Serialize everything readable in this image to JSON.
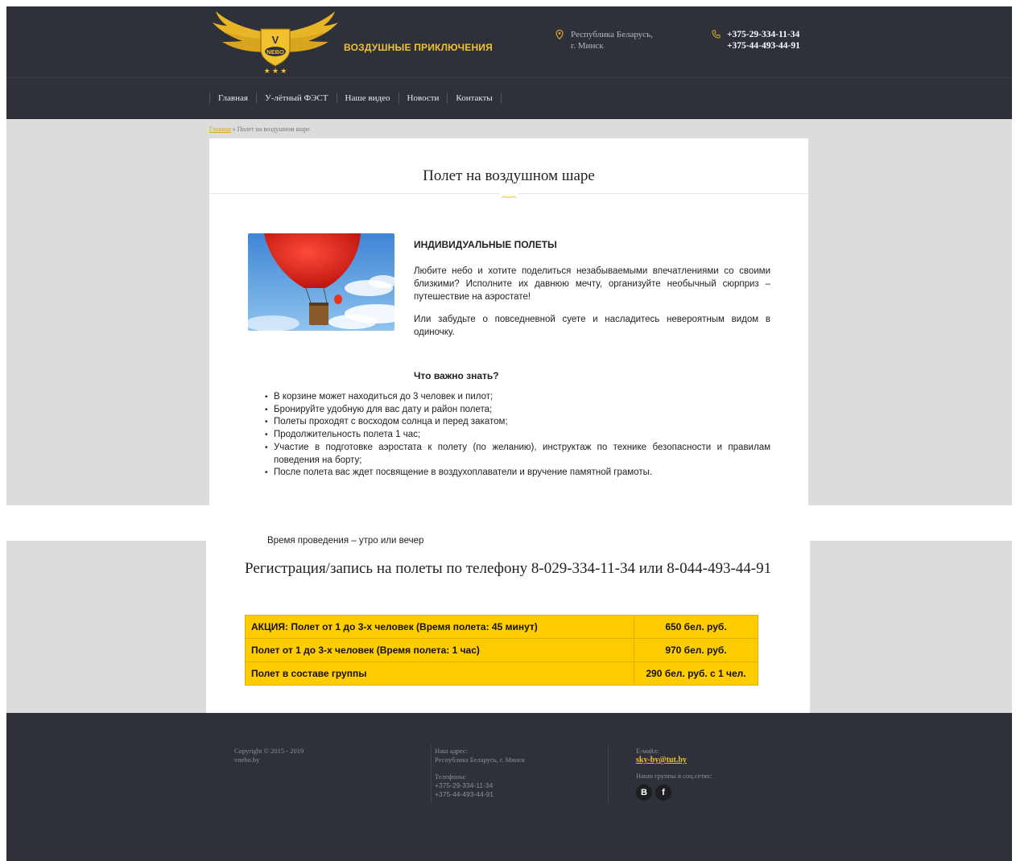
{
  "header": {
    "logo_badge": "V",
    "logo_word": "NEBO",
    "logo_text": "ВОЗДУШНЫЕ ПРИКЛЮЧЕНИЯ",
    "address_line1": "Республика Беларусь,",
    "address_line2": "г. Минск",
    "phone1": "+375-29-334-11-34",
    "phone2": "+375-44-493-44-91"
  },
  "nav": {
    "items": [
      "Главная",
      "У-лётный ФЭСТ",
      "Наше видео",
      "Новости",
      "Контакты"
    ]
  },
  "breadcrumb": {
    "home": "Главная",
    "separator": " » ",
    "current": "Полет на воздушном шаре"
  },
  "content": {
    "page_title": "Полет на воздушном шаре",
    "section_title": "ИНДИВИДУАЛЬНЫЕ ПОЛЕТЫ",
    "para1": "Любите небо и хотите поделиться незабываемыми впечатлениями со своими близкими? Исполните их давнюю мечту, организуйте необычный сюрприз – путешествие на аэростате!",
    "para2": "Или забудьте о повседневной суете и насладитесь невероятным видом в одиночку.",
    "know_title": "Что важно знать?",
    "know_items": [
      "В корзине может находиться до 3 человек и пилот;",
      "Бронируйте удобную для вас дату и район полета;",
      "Полеты проходят с восходом солнца и перед закатом;",
      "Продолжительность полета 1 час;",
      "Участие в подготовке аэростата к полету (по желанию), инструктаж по технике безопасности и правилам поведения на борту;",
      "После полета вас ждет посвящение в воздухоплаватели и вручение памятной грамоты."
    ],
    "cut_item": "Время проведения – утро или вечер",
    "registration": "Регистрация/запись на полеты по телефону 8-029-334-11-34 или 8-044-493-44-91"
  },
  "prices": [
    {
      "name": "АКЦИЯ: Полет от 1 до 3-х человек (Время полета: 45 минут)",
      "price": "650 бел. руб."
    },
    {
      "name": "Полет от 1 до 3-х человек (Время полета: 1 час)",
      "price": "970 бел. руб."
    },
    {
      "name": "Полет в составе группы",
      "price": "290 бел. руб. с 1 чел."
    }
  ],
  "footer": {
    "copyright": "Copyright © 2015 - 2019",
    "site": "vnebo.by",
    "address_label": "Наш адрес:",
    "address": "Республика Беларусь, г. Минск",
    "phones_label": "Телефоны:",
    "phone1": "+375-29-334-11-34",
    "phone2": "+375-44-493-44-91",
    "email_label": "E-майл:",
    "email": "sky-by@tut.by",
    "social_label": "Наши группы в соц.сетях:",
    "social_vk": "В",
    "social_fb": "f"
  },
  "colors": {
    "dark": "#2e3139",
    "gold": "#f2c12e",
    "price_bg": "#ffcc00",
    "page_bg": "#dcdcdc"
  },
  "icons": [
    "logo-wings-emblem",
    "map-pin-icon",
    "phone-icon",
    "vk-icon",
    "facebook-icon"
  ]
}
